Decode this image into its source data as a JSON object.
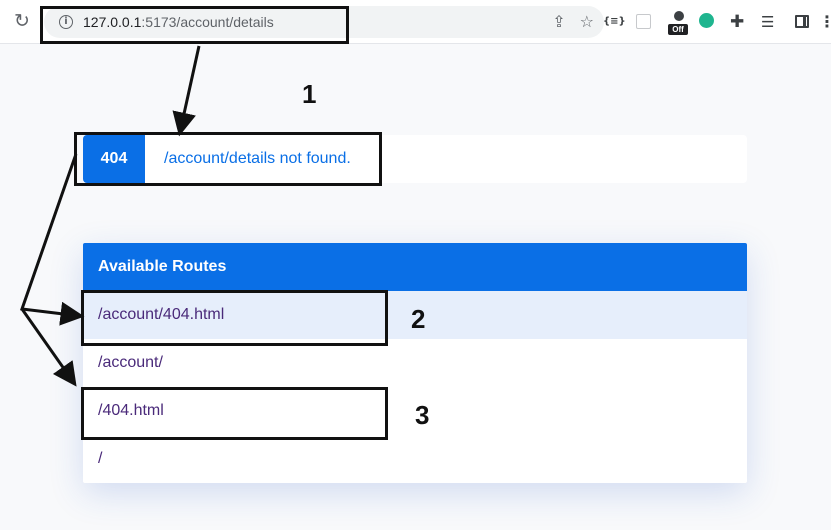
{
  "browser": {
    "url_host": "127.0.0.1",
    "url_rest": ":5173/account/details",
    "icons": [
      "reload-icon",
      "site-info-icon",
      "share-icon",
      "bookmark-star-icon",
      "json-extension-icon",
      "extension-square-icon",
      "extension-off-icon",
      "extension-green-icon",
      "puzzle-extensions-icon",
      "reading-list-icon",
      "side-panel-icon",
      "menu-icon"
    ],
    "off_badge": "Off",
    "json_ext_label": "{≡}"
  },
  "notfound": {
    "code": "404",
    "message": "/account/details not found."
  },
  "routes": {
    "header": "Available Routes",
    "items": [
      {
        "path": "/account/404.html",
        "active": true
      },
      {
        "path": "/account/",
        "active": false
      },
      {
        "path": "/404.html",
        "active": false
      },
      {
        "path": "/",
        "active": false
      }
    ]
  },
  "annotations": {
    "labels": [
      "1",
      "2",
      "3"
    ]
  },
  "colors": {
    "accent": "#0a6fe6",
    "active_row": "#e6eefb",
    "route_text": "#4a2a7a",
    "annotation": "#111111"
  }
}
